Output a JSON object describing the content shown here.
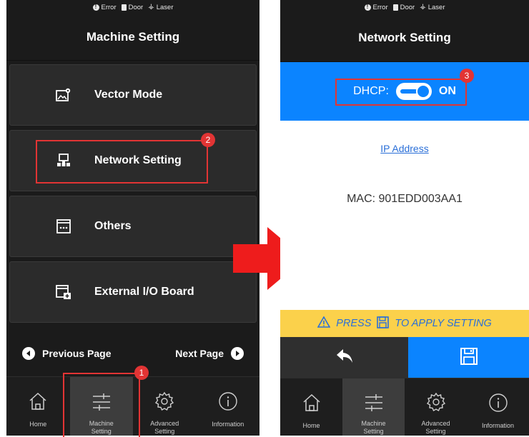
{
  "status_bar": {
    "error": "Error",
    "door": "Door",
    "laser": "Laser"
  },
  "left_screen": {
    "title": "Machine Setting",
    "menu": [
      {
        "label": "Vector Mode",
        "icon": "image-gear-icon"
      },
      {
        "label": "Network Setting",
        "icon": "network-icon"
      },
      {
        "label": "Others",
        "icon": "window-dots-icon"
      },
      {
        "label": "External I/O Board",
        "icon": "io-board-icon"
      }
    ],
    "pager": {
      "prev": "Previous Page",
      "next": "Next Page"
    }
  },
  "right_screen": {
    "title": "Network Setting",
    "dhcp_label": "DHCP:",
    "dhcp_state": "ON",
    "dhcp_enabled": true,
    "ip_link": "IP Address",
    "mac": "MAC: 901EDD003AA1",
    "press_prefix": "PRESS",
    "press_suffix": "TO APPLY SETTING"
  },
  "nav": [
    {
      "label": "Home",
      "icon": "home-icon"
    },
    {
      "label": "Machine\nSetting",
      "icon": "sliders-icon"
    },
    {
      "label": "Advanced\nSetting",
      "icon": "gear-icon"
    },
    {
      "label": "Information",
      "icon": "info-icon"
    }
  ],
  "callouts": {
    "step1": "1",
    "step2": "2",
    "step3": "3"
  },
  "colors": {
    "accent_blue": "#0b84ff",
    "callout_red": "#e23434",
    "warning_yellow": "#fbd14b",
    "dark_bg": "#1b1b1b"
  }
}
